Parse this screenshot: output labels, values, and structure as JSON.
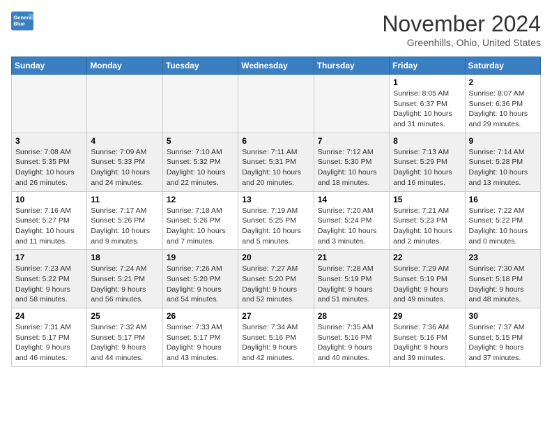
{
  "header": {
    "logo_line1": "General",
    "logo_line2": "Blue",
    "month": "November 2024",
    "location": "Greenhills, Ohio, United States"
  },
  "days_of_week": [
    "Sunday",
    "Monday",
    "Tuesday",
    "Wednesday",
    "Thursday",
    "Friday",
    "Saturday"
  ],
  "weeks": [
    [
      {
        "day": "",
        "info": ""
      },
      {
        "day": "",
        "info": ""
      },
      {
        "day": "",
        "info": ""
      },
      {
        "day": "",
        "info": ""
      },
      {
        "day": "",
        "info": ""
      },
      {
        "day": "1",
        "info": "Sunrise: 8:05 AM\nSunset: 6:37 PM\nDaylight: 10 hours and 31 minutes."
      },
      {
        "day": "2",
        "info": "Sunrise: 8:07 AM\nSunset: 6:36 PM\nDaylight: 10 hours and 29 minutes."
      }
    ],
    [
      {
        "day": "3",
        "info": "Sunrise: 7:08 AM\nSunset: 5:35 PM\nDaylight: 10 hours and 26 minutes."
      },
      {
        "day": "4",
        "info": "Sunrise: 7:09 AM\nSunset: 5:33 PM\nDaylight: 10 hours and 24 minutes."
      },
      {
        "day": "5",
        "info": "Sunrise: 7:10 AM\nSunset: 5:32 PM\nDaylight: 10 hours and 22 minutes."
      },
      {
        "day": "6",
        "info": "Sunrise: 7:11 AM\nSunset: 5:31 PM\nDaylight: 10 hours and 20 minutes."
      },
      {
        "day": "7",
        "info": "Sunrise: 7:12 AM\nSunset: 5:30 PM\nDaylight: 10 hours and 18 minutes."
      },
      {
        "day": "8",
        "info": "Sunrise: 7:13 AM\nSunset: 5:29 PM\nDaylight: 10 hours and 16 minutes."
      },
      {
        "day": "9",
        "info": "Sunrise: 7:14 AM\nSunset: 5:28 PM\nDaylight: 10 hours and 13 minutes."
      }
    ],
    [
      {
        "day": "10",
        "info": "Sunrise: 7:16 AM\nSunset: 5:27 PM\nDaylight: 10 hours and 11 minutes."
      },
      {
        "day": "11",
        "info": "Sunrise: 7:17 AM\nSunset: 5:26 PM\nDaylight: 10 hours and 9 minutes."
      },
      {
        "day": "12",
        "info": "Sunrise: 7:18 AM\nSunset: 5:26 PM\nDaylight: 10 hours and 7 minutes."
      },
      {
        "day": "13",
        "info": "Sunrise: 7:19 AM\nSunset: 5:25 PM\nDaylight: 10 hours and 5 minutes."
      },
      {
        "day": "14",
        "info": "Sunrise: 7:20 AM\nSunset: 5:24 PM\nDaylight: 10 hours and 3 minutes."
      },
      {
        "day": "15",
        "info": "Sunrise: 7:21 AM\nSunset: 5:23 PM\nDaylight: 10 hours and 2 minutes."
      },
      {
        "day": "16",
        "info": "Sunrise: 7:22 AM\nSunset: 5:22 PM\nDaylight: 10 hours and 0 minutes."
      }
    ],
    [
      {
        "day": "17",
        "info": "Sunrise: 7:23 AM\nSunset: 5:22 PM\nDaylight: 9 hours and 58 minutes."
      },
      {
        "day": "18",
        "info": "Sunrise: 7:24 AM\nSunset: 5:21 PM\nDaylight: 9 hours and 56 minutes."
      },
      {
        "day": "19",
        "info": "Sunrise: 7:26 AM\nSunset: 5:20 PM\nDaylight: 9 hours and 54 minutes."
      },
      {
        "day": "20",
        "info": "Sunrise: 7:27 AM\nSunset: 5:20 PM\nDaylight: 9 hours and 52 minutes."
      },
      {
        "day": "21",
        "info": "Sunrise: 7:28 AM\nSunset: 5:19 PM\nDaylight: 9 hours and 51 minutes."
      },
      {
        "day": "22",
        "info": "Sunrise: 7:29 AM\nSunset: 5:19 PM\nDaylight: 9 hours and 49 minutes."
      },
      {
        "day": "23",
        "info": "Sunrise: 7:30 AM\nSunset: 5:18 PM\nDaylight: 9 hours and 48 minutes."
      }
    ],
    [
      {
        "day": "24",
        "info": "Sunrise: 7:31 AM\nSunset: 5:17 PM\nDaylight: 9 hours and 46 minutes."
      },
      {
        "day": "25",
        "info": "Sunrise: 7:32 AM\nSunset: 5:17 PM\nDaylight: 9 hours and 44 minutes."
      },
      {
        "day": "26",
        "info": "Sunrise: 7:33 AM\nSunset: 5:17 PM\nDaylight: 9 hours and 43 minutes."
      },
      {
        "day": "27",
        "info": "Sunrise: 7:34 AM\nSunset: 5:16 PM\nDaylight: 9 hours and 42 minutes."
      },
      {
        "day": "28",
        "info": "Sunrise: 7:35 AM\nSunset: 5:16 PM\nDaylight: 9 hours and 40 minutes."
      },
      {
        "day": "29",
        "info": "Sunrise: 7:36 AM\nSunset: 5:16 PM\nDaylight: 9 hours and 39 minutes."
      },
      {
        "day": "30",
        "info": "Sunrise: 7:37 AM\nSunset: 5:15 PM\nDaylight: 9 hours and 37 minutes."
      }
    ]
  ]
}
